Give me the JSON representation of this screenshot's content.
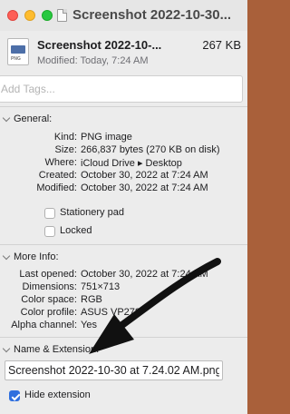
{
  "window": {
    "title": "Screenshot 2022-10-30..."
  },
  "header": {
    "file_name": "Screenshot 2022-10-...",
    "file_size": "267 KB",
    "modified": "Modified: Today, 7:24 AM",
    "icon_badge": "PNG"
  },
  "tags": {
    "placeholder": "Add Tags..."
  },
  "general": {
    "heading": "General:",
    "rows": [
      {
        "key": "Kind:",
        "value": "PNG image"
      },
      {
        "key": "Size:",
        "value": "266,837 bytes (270 KB on disk)"
      },
      {
        "key": "Where:",
        "value": "iCloud Drive ▸ Desktop"
      },
      {
        "key": "Created:",
        "value": "October 30, 2022 at 7:24 AM"
      },
      {
        "key": "Modified:",
        "value": "October 30, 2022 at 7:24 AM"
      }
    ],
    "stationery_label": "Stationery pad",
    "locked_label": "Locked"
  },
  "more_info": {
    "heading": "More Info:",
    "rows": [
      {
        "key": "Last opened:",
        "value": "October 30, 2022 at 7:24 AM"
      },
      {
        "key": "Dimensions:",
        "value": "751×713"
      },
      {
        "key": "Color space:",
        "value": "RGB"
      },
      {
        "key": "Color profile:",
        "value": "ASUS VP278"
      },
      {
        "key": "Alpha channel:",
        "value": "Yes"
      }
    ]
  },
  "name_extension": {
    "heading": "Name & Extension:",
    "value": "Screenshot 2022-10-30 at 7.24.02 AM.png",
    "hide_extension_label": "Hide extension",
    "hide_extension_checked": true
  },
  "colors": {
    "traffic_red": "#fe5f57",
    "traffic_yellow": "#febc2e",
    "traffic_green": "#28c840",
    "accent": "#2f6fde",
    "annotation_arrow": "#111111"
  }
}
